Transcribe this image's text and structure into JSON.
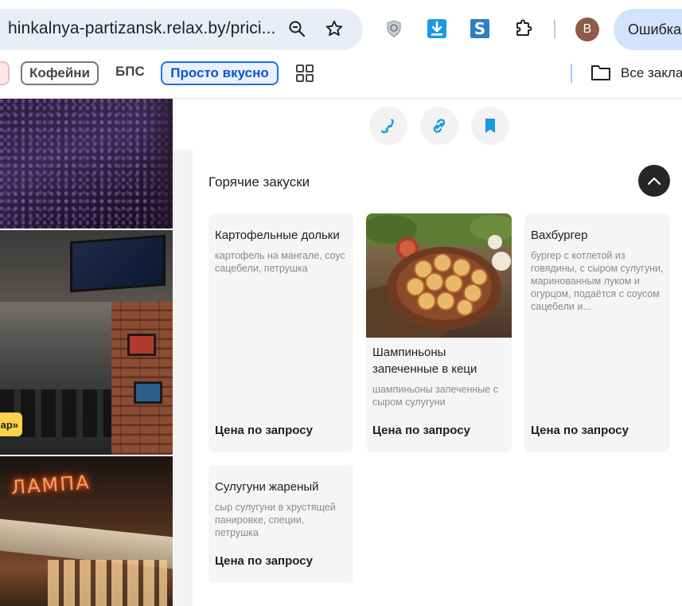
{
  "browser": {
    "url": "hinkalnya-partizansk.relax.by/prici...",
    "error_label": "Ошибка",
    "avatar_letter": "B",
    "extensions": [
      "shield-icon",
      "download-icon",
      "s-extension-icon",
      "puzzle-icon"
    ]
  },
  "bookmarks": {
    "items": [
      {
        "label": "Кофейни"
      },
      {
        "label": "БПС"
      },
      {
        "label": "Просто вкусно"
      }
    ],
    "all_label": "Все закла"
  },
  "left_gallery": {
    "tag_text": "ар»",
    "sign_text": "ЛАМПА"
  },
  "section": {
    "title": "Горячие закуски"
  },
  "dishes": [
    {
      "title": "Картофельные дольки",
      "description": "картофель на мангале, соус сацебели, петрушка",
      "price": "Цена по запросу"
    },
    {
      "title": "Шампиньоны запеченные в кеци",
      "description": "шампиньоны запеченные с сыром сулугуни",
      "price": "Цена по запросу"
    },
    {
      "title": "Вахбургер",
      "description": "бургер с котлетой из говядины, с сыром сулугуни, маринованным луком и огурцом, подаётся с соусом сацебели и...",
      "price": "Цена по запросу"
    },
    {
      "title": "Сулугуни жареный",
      "description": "сыр сулугуни в хрустящей панировке, специи, петрушка",
      "price": "Цена по запросу"
    }
  ],
  "colors": {
    "accent": "#1a9ae0",
    "omnibox_bg": "#e9eef6",
    "card_bg": "#f5f5f5"
  }
}
